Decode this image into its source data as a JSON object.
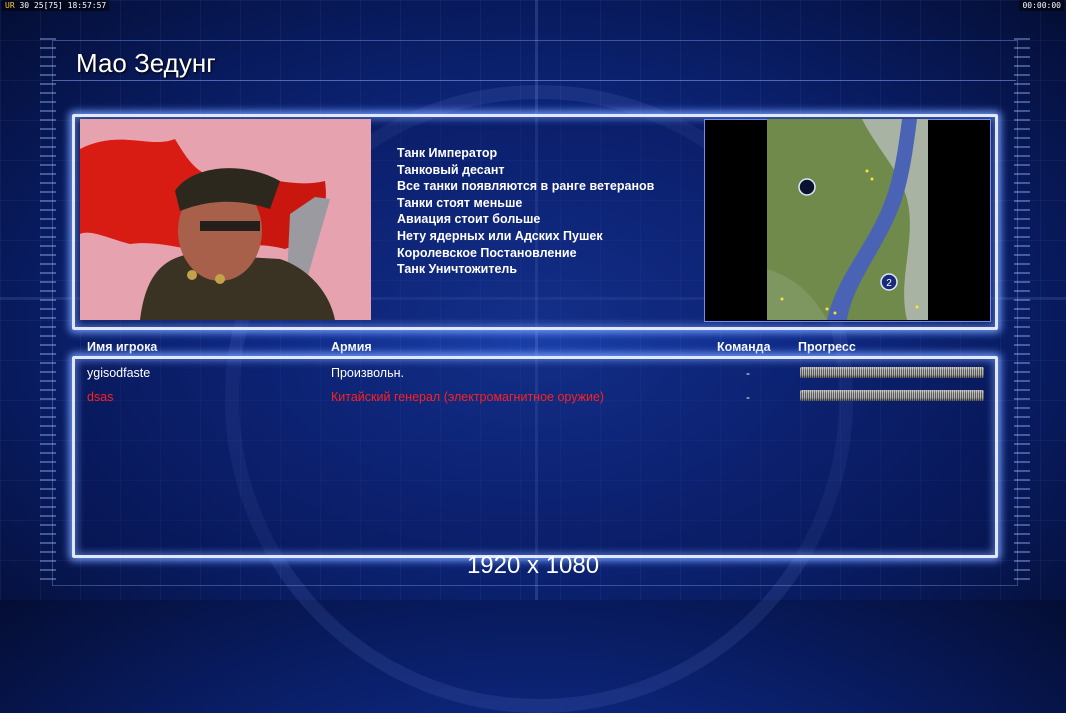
{
  "overlay": {
    "fps_label": "UR",
    "fps_value": "30",
    "fps_extra": "25",
    "fps_bracket": "[75]",
    "clock": "18:57:57",
    "timer": "00:00:00"
  },
  "general": {
    "name": "Мао Зедунг",
    "features": [
      "Танк Император",
      "Танковый десант",
      "Все танки появляются в ранге ветеранов",
      "Танки стоят меньше",
      "Авиация стоит больше",
      "Нету ядерных или Адских Пушек",
      "Королевское Постановление",
      "Танк Уничтожитель"
    ]
  },
  "minimap": {
    "start_marker": "2"
  },
  "players_table": {
    "headers": {
      "name": "Имя игрока",
      "army": "Армия",
      "team": "Команда",
      "progress": "Прогресс"
    },
    "rows": [
      {
        "name": "ygisodfaste",
        "army": "Произвольн.",
        "team": "-",
        "progress": 0,
        "color": "#ffffff"
      },
      {
        "name": "dsas",
        "army": "Китайский генерал (электромагнитное оружие)",
        "team": "-",
        "progress": 0,
        "color": "#ff2020"
      }
    ]
  },
  "resolution": "1920 x 1080",
  "colors": {
    "accent_glow": "#dfe8ff",
    "player_red": "#ff2020",
    "background_blue": "#0f2a86"
  }
}
